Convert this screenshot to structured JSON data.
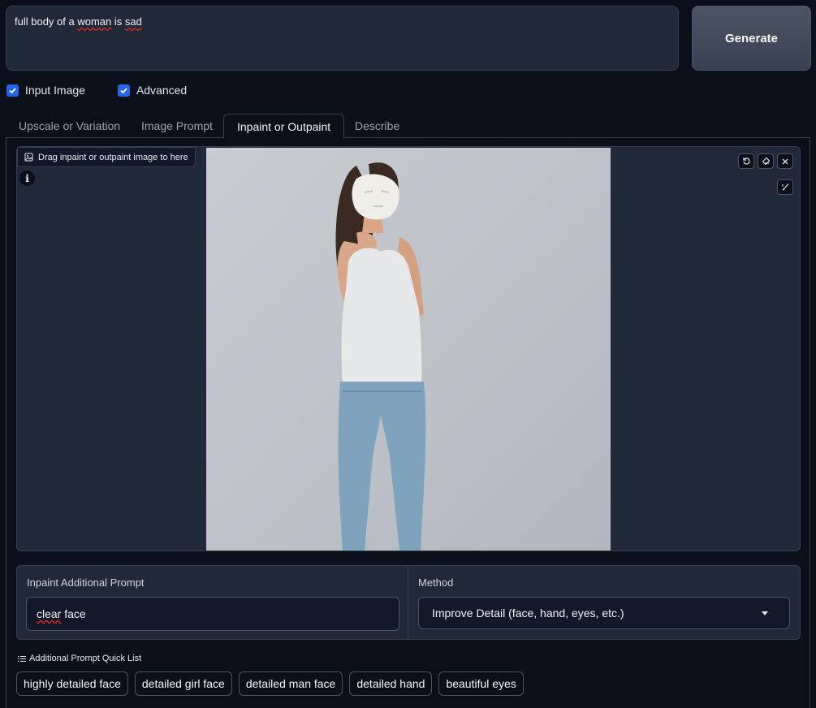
{
  "prompt": {
    "text_prefix": "full body of a ",
    "text_squiggly": "woman",
    "text_mid": " is ",
    "text_squiggly2": "sad"
  },
  "generate_label": "Generate",
  "checks": {
    "input_image": "Input Image",
    "advanced": "Advanced"
  },
  "tabs": [
    {
      "label": "Upscale or Variation"
    },
    {
      "label": "Image Prompt"
    },
    {
      "label": "Inpaint or Outpaint"
    },
    {
      "label": "Describe"
    }
  ],
  "canvas": {
    "drop_label": "Drag inpaint or outpaint image to here",
    "info": "i"
  },
  "inpaint": {
    "prompt_label": "Inpaint Additional Prompt",
    "prompt_value_squiggly": "clear",
    "prompt_value_rest": " face",
    "method_label": "Method",
    "method_value": "Improve Detail (face, hand, eyes, etc.)"
  },
  "quick_list": {
    "title": "Additional Prompt Quick List",
    "items": [
      "highly detailed face",
      "detailed girl face",
      "detailed man face",
      "detailed hand",
      "beautiful eyes"
    ]
  },
  "colors": {
    "background": "#0b0f19",
    "panel": "#1f2937",
    "accent": "#2563eb"
  }
}
